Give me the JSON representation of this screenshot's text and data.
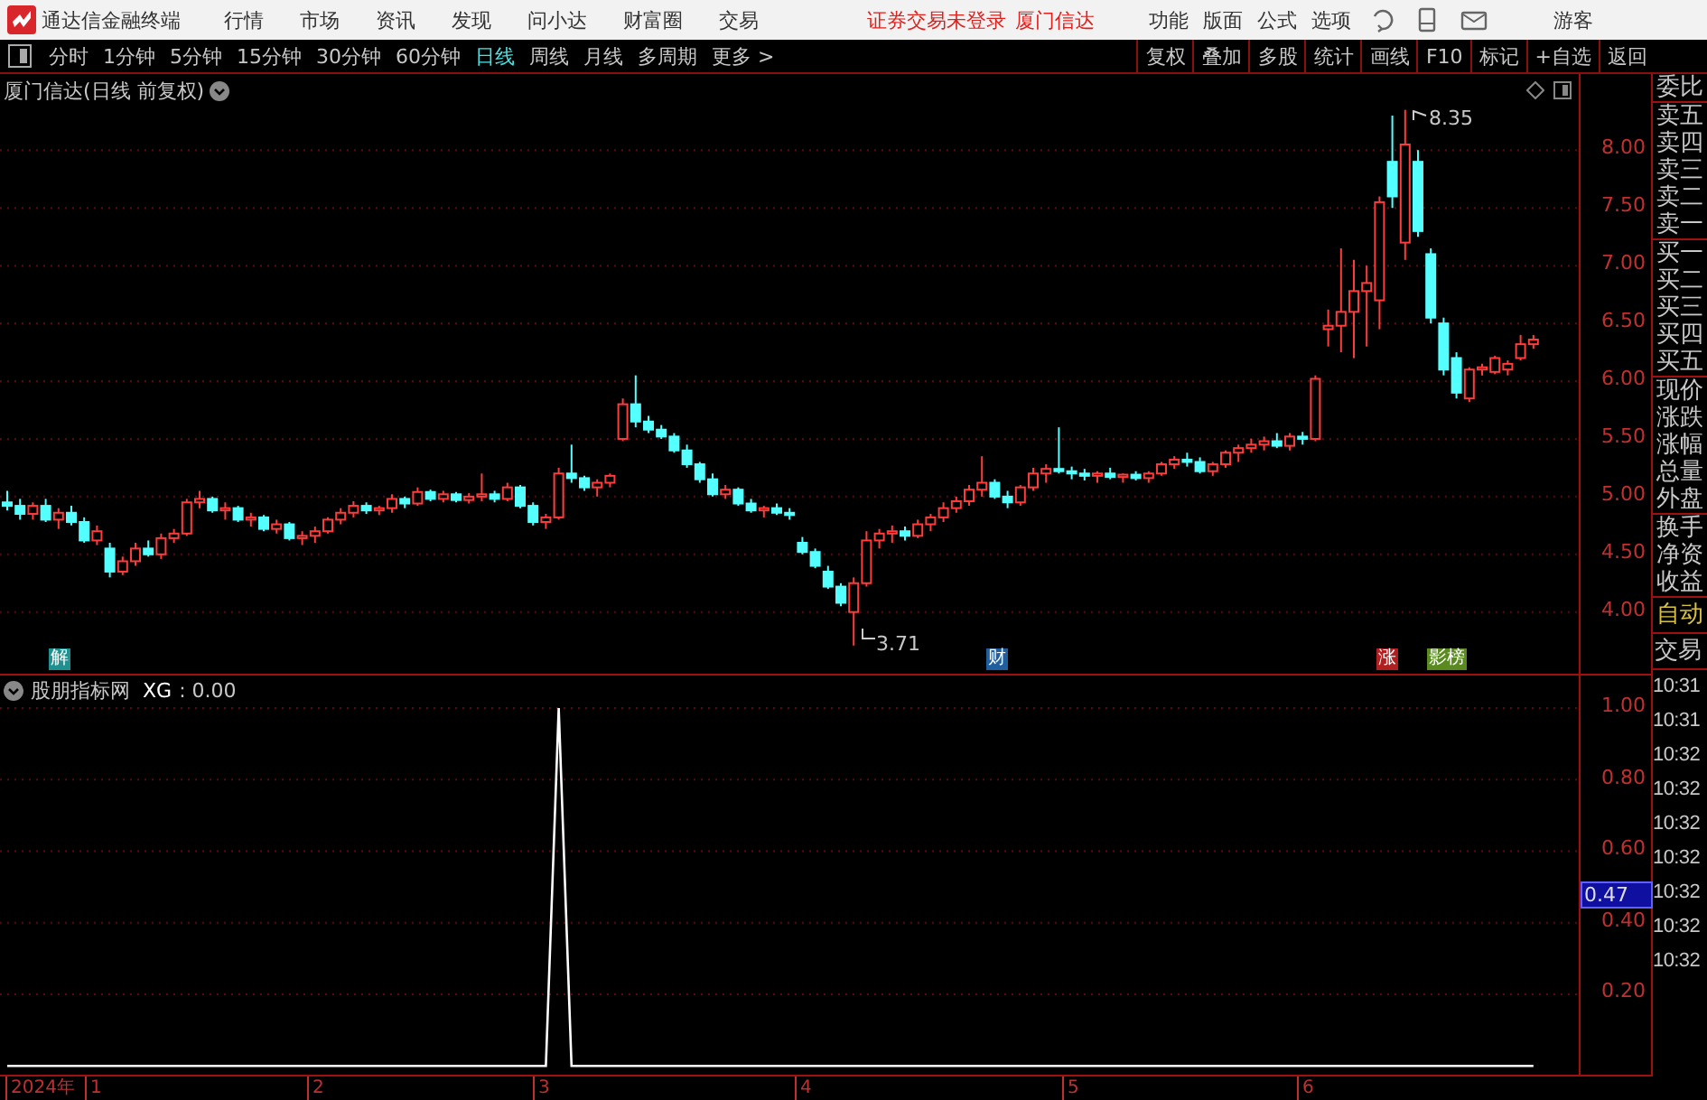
{
  "app": {
    "title": "通达信金融终端"
  },
  "menu": [
    "行情",
    "市场",
    "资讯",
    "发现",
    "问小达",
    "财富圈",
    "交易"
  ],
  "login_status": "证券交易未登录",
  "broker": "厦门信达",
  "right_menu": [
    "功能",
    "版面",
    "公式",
    "选项"
  ],
  "user": "游客",
  "periods": [
    {
      "label": "分时",
      "selected": false
    },
    {
      "label": "1分钟",
      "selected": false
    },
    {
      "label": "5分钟",
      "selected": false
    },
    {
      "label": "15分钟",
      "selected": false
    },
    {
      "label": "30分钟",
      "selected": false
    },
    {
      "label": "60分钟",
      "selected": false
    },
    {
      "label": "日线",
      "selected": true
    },
    {
      "label": "周线",
      "selected": false
    },
    {
      "label": "月线",
      "selected": false
    },
    {
      "label": "多周期",
      "selected": false
    },
    {
      "label": "更多 >",
      "selected": false
    }
  ],
  "tools": [
    "复权",
    "叠加",
    "多股",
    "统计",
    "画线",
    "F10",
    "标记",
    "+自选",
    "返回"
  ],
  "price_chart": {
    "title": "厦门信达(日线 前复权)",
    "high_label": "8.35",
    "low_label": "3.71",
    "events": [
      {
        "label": "解",
        "color": "#1f8f8f"
      },
      {
        "label": "财",
        "color": "#1f5f9f"
      },
      {
        "label": "涨",
        "color": "#b02020"
      },
      {
        "label": "影榜",
        "color": "#5a8a20"
      }
    ],
    "chart_data": {
      "type": "candlestick",
      "categories": [
        null,
        null,
        null,
        null,
        null,
        null,
        null,
        null,
        null,
        null,
        null,
        null,
        null,
        null,
        null,
        null,
        null,
        null,
        null,
        null,
        null,
        null,
        null,
        null,
        null,
        null,
        null,
        null,
        null,
        null,
        null,
        null,
        null,
        null,
        null,
        null,
        null,
        null,
        null,
        null,
        null,
        null,
        null,
        null,
        null,
        null,
        null,
        null,
        null,
        null,
        null,
        null,
        null,
        null,
        null,
        null,
        null,
        null,
        null,
        null,
        null,
        null,
        null,
        null,
        null,
        null,
        null,
        null,
        null,
        null,
        null,
        null,
        null,
        null,
        null,
        null,
        null,
        null,
        null,
        null,
        null,
        null,
        null,
        null,
        null,
        null,
        null,
        null,
        null,
        null,
        null,
        null,
        null,
        null,
        null,
        null,
        null,
        null,
        null,
        null,
        null,
        null,
        null,
        null,
        null,
        null,
        null,
        null,
        null,
        null,
        null,
        null,
        null,
        null,
        null,
        null,
        null,
        null,
        null,
        null
      ],
      "ylim": [
        3.45,
        8.66
      ],
      "grid": true,
      "yticks": [
        {
          "value": 8,
          "label": "8.00"
        },
        {
          "value": 7.5,
          "label": "7.50"
        },
        {
          "value": 7,
          "label": "7.00"
        },
        {
          "value": 6.5,
          "label": "6.50"
        },
        {
          "value": 6,
          "label": "6.00"
        },
        {
          "value": 5.5,
          "label": "5.50"
        },
        {
          "value": 5,
          "label": "5.00"
        },
        {
          "value": 4.5,
          "label": "4.50"
        },
        {
          "value": 4,
          "label": "4.00"
        }
      ],
      "ohlc": [
        [
          4.95,
          5.05,
          4.88,
          4.92
        ],
        [
          4.92,
          4.98,
          4.8,
          4.85
        ],
        [
          4.85,
          4.95,
          4.8,
          4.92
        ],
        [
          4.92,
          4.98,
          4.78,
          4.8
        ],
        [
          4.8,
          4.9,
          4.72,
          4.86
        ],
        [
          4.86,
          4.92,
          4.75,
          4.78
        ],
        [
          4.78,
          4.82,
          4.6,
          4.62
        ],
        [
          4.62,
          4.75,
          4.58,
          4.7
        ],
        [
          4.55,
          4.6,
          4.3,
          4.35
        ],
        [
          4.35,
          4.48,
          4.32,
          4.44
        ],
        [
          4.44,
          4.6,
          4.4,
          4.55
        ],
        [
          4.55,
          4.62,
          4.48,
          4.5
        ],
        [
          4.5,
          4.68,
          4.46,
          4.64
        ],
        [
          4.64,
          4.72,
          4.6,
          4.68
        ],
        [
          4.68,
          4.98,
          4.66,
          4.95
        ],
        [
          4.95,
          5.05,
          4.9,
          4.98
        ],
        [
          4.98,
          5.0,
          4.86,
          4.88
        ],
        [
          4.88,
          4.95,
          4.8,
          4.9
        ],
        [
          4.9,
          4.92,
          4.78,
          4.8
        ],
        [
          4.8,
          4.86,
          4.74,
          4.82
        ],
        [
          4.82,
          4.84,
          4.7,
          4.72
        ],
        [
          4.72,
          4.8,
          4.68,
          4.76
        ],
        [
          4.76,
          4.78,
          4.62,
          4.64
        ],
        [
          4.64,
          4.7,
          4.58,
          4.66
        ],
        [
          4.66,
          4.74,
          4.6,
          4.7
        ],
        [
          4.7,
          4.82,
          4.68,
          4.8
        ],
        [
          4.8,
          4.9,
          4.76,
          4.86
        ],
        [
          4.86,
          4.96,
          4.82,
          4.92
        ],
        [
          4.92,
          4.95,
          4.85,
          4.88
        ],
        [
          4.88,
          4.92,
          4.84,
          4.9
        ],
        [
          4.9,
          5.02,
          4.86,
          4.98
        ],
        [
          4.98,
          5.0,
          4.9,
          4.94
        ],
        [
          4.94,
          5.08,
          4.92,
          5.04
        ],
        [
          5.04,
          5.06,
          4.96,
          4.98
        ],
        [
          4.98,
          5.05,
          4.95,
          5.02
        ],
        [
          5.02,
          5.04,
          4.95,
          4.97
        ],
        [
          4.97,
          5.03,
          4.94,
          5.0
        ],
        [
          5.0,
          5.2,
          4.96,
          5.02
        ],
        [
          5.02,
          5.05,
          4.95,
          4.98
        ],
        [
          4.98,
          5.12,
          4.96,
          5.08
        ],
        [
          5.08,
          5.1,
          4.9,
          4.92
        ],
        [
          4.92,
          4.95,
          4.75,
          4.78
        ],
        [
          4.78,
          4.85,
          4.72,
          4.82
        ],
        [
          4.82,
          5.25,
          4.8,
          5.2
        ],
        [
          5.2,
          5.45,
          5.12,
          5.16
        ],
        [
          5.16,
          5.18,
          5.05,
          5.08
        ],
        [
          5.08,
          5.15,
          5.0,
          5.12
        ],
        [
          5.12,
          5.2,
          5.08,
          5.18
        ],
        [
          5.5,
          5.85,
          5.48,
          5.8
        ],
        [
          5.8,
          6.05,
          5.6,
          5.65
        ],
        [
          5.65,
          5.7,
          5.55,
          5.58
        ],
        [
          5.58,
          5.62,
          5.5,
          5.52
        ],
        [
          5.52,
          5.55,
          5.38,
          5.4
        ],
        [
          5.4,
          5.45,
          5.25,
          5.28
        ],
        [
          5.28,
          5.3,
          5.12,
          5.15
        ],
        [
          5.15,
          5.2,
          5.0,
          5.02
        ],
        [
          5.02,
          5.1,
          4.98,
          5.06
        ],
        [
          5.06,
          5.08,
          4.92,
          4.94
        ],
        [
          4.94,
          4.98,
          4.86,
          4.88
        ],
        [
          4.88,
          4.92,
          4.82,
          4.9
        ],
        [
          4.9,
          4.94,
          4.84,
          4.86
        ],
        [
          4.86,
          4.9,
          4.8,
          4.84
        ],
        [
          4.6,
          4.65,
          4.5,
          4.52
        ],
        [
          4.52,
          4.55,
          4.38,
          4.4
        ],
        [
          4.35,
          4.4,
          4.2,
          4.22
        ],
        [
          4.22,
          4.25,
          4.05,
          4.08
        ],
        [
          4.0,
          4.3,
          3.71,
          4.25
        ],
        [
          4.25,
          4.7,
          4.22,
          4.62
        ],
        [
          4.62,
          4.72,
          4.55,
          4.68
        ],
        [
          4.68,
          4.75,
          4.6,
          4.7
        ],
        [
          4.7,
          4.74,
          4.62,
          4.66
        ],
        [
          4.66,
          4.8,
          4.64,
          4.76
        ],
        [
          4.76,
          4.85,
          4.7,
          4.82
        ],
        [
          4.82,
          4.95,
          4.78,
          4.9
        ],
        [
          4.9,
          5.0,
          4.86,
          4.96
        ],
        [
          4.96,
          5.1,
          4.92,
          5.06
        ],
        [
          5.06,
          5.35,
          5.0,
          5.12
        ],
        [
          5.12,
          5.15,
          4.98,
          5.0
        ],
        [
          5.0,
          5.05,
          4.9,
          4.95
        ],
        [
          4.95,
          5.1,
          4.92,
          5.08
        ],
        [
          5.08,
          5.25,
          5.05,
          5.2
        ],
        [
          5.2,
          5.28,
          5.12,
          5.24
        ],
        [
          5.24,
          5.6,
          5.2,
          5.22
        ],
        [
          5.22,
          5.26,
          5.15,
          5.2
        ],
        [
          5.2,
          5.24,
          5.14,
          5.18
        ],
        [
          5.18,
          5.22,
          5.12,
          5.2
        ],
        [
          5.2,
          5.25,
          5.15,
          5.17
        ],
        [
          5.17,
          5.2,
          5.12,
          5.19
        ],
        [
          5.19,
          5.22,
          5.14,
          5.16
        ],
        [
          5.16,
          5.22,
          5.12,
          5.2
        ],
        [
          5.2,
          5.3,
          5.18,
          5.28
        ],
        [
          5.28,
          5.35,
          5.24,
          5.32
        ],
        [
          5.32,
          5.38,
          5.26,
          5.3
        ],
        [
          5.3,
          5.34,
          5.2,
          5.22
        ],
        [
          5.22,
          5.3,
          5.18,
          5.28
        ],
        [
          5.28,
          5.4,
          5.25,
          5.38
        ],
        [
          5.38,
          5.45,
          5.3,
          5.42
        ],
        [
          5.42,
          5.5,
          5.38,
          5.45
        ],
        [
          5.45,
          5.52,
          5.4,
          5.48
        ],
        [
          5.48,
          5.55,
          5.42,
          5.44
        ],
        [
          5.44,
          5.55,
          5.4,
          5.52
        ],
        [
          5.52,
          5.56,
          5.45,
          5.5
        ],
        [
          5.5,
          6.05,
          5.48,
          6.02
        ],
        [
          6.45,
          6.62,
          6.3,
          6.48
        ],
        [
          6.48,
          7.15,
          6.25,
          6.6
        ],
        [
          6.6,
          7.05,
          6.2,
          6.78
        ],
        [
          6.78,
          7.0,
          6.3,
          6.85
        ],
        [
          6.7,
          7.6,
          6.45,
          7.55
        ],
        [
          7.9,
          8.3,
          7.5,
          7.6
        ],
        [
          7.2,
          8.35,
          7.05,
          8.05
        ],
        [
          7.9,
          8.0,
          7.25,
          7.3
        ],
        [
          7.1,
          7.15,
          6.5,
          6.55
        ],
        [
          6.5,
          6.55,
          6.05,
          6.1
        ],
        [
          6.2,
          6.25,
          5.85,
          5.9
        ],
        [
          5.85,
          6.12,
          5.82,
          6.1
        ],
        [
          6.1,
          6.15,
          6.05,
          6.12
        ],
        [
          6.08,
          6.22,
          6.06,
          6.2
        ],
        [
          6.1,
          6.18,
          6.05,
          6.15
        ],
        [
          6.2,
          6.4,
          6.18,
          6.32
        ],
        [
          6.32,
          6.4,
          6.28,
          6.36
        ]
      ]
    }
  },
  "indicator": {
    "title": "股朋指标网",
    "reading": ": 0.00",
    "cursor_value": "0.47",
    "chart_data": {
      "type": "line",
      "categories": [
        null,
        null,
        null,
        null,
        null,
        null,
        null,
        null,
        null,
        null,
        null,
        null,
        null,
        null,
        null,
        null,
        null,
        null,
        null,
        null,
        null,
        null,
        null,
        null,
        null,
        null,
        null,
        null,
        null,
        null,
        null,
        null,
        null,
        null,
        null,
        null,
        null,
        null,
        null,
        null,
        null,
        null,
        null,
        null,
        null,
        null,
        null,
        null,
        null,
        null,
        null,
        null,
        null,
        null,
        null,
        null,
        null,
        null,
        null,
        null,
        null,
        null,
        null,
        null,
        null,
        null,
        null,
        null,
        null,
        null,
        null,
        null,
        null,
        null,
        null,
        null,
        null,
        null,
        null,
        null,
        null,
        null,
        null,
        null,
        null,
        null,
        null,
        null,
        null,
        null,
        null,
        null,
        null,
        null,
        null,
        null,
        null,
        null,
        null,
        null,
        null,
        null,
        null,
        null,
        null,
        null,
        null,
        null,
        null,
        null,
        null,
        null,
        null,
        null,
        null,
        null,
        null,
        null,
        null,
        null
      ],
      "ylim": [
        -0.03,
        1
      ],
      "grid": true,
      "yticks": [
        {
          "value": 0.2,
          "label": "0.20"
        },
        {
          "value": 0.4,
          "label": "0.40"
        },
        {
          "value": 0.6,
          "label": "0.60"
        },
        {
          "value": 0.8,
          "label": "0.80"
        },
        {
          "value": 1,
          "label": "1.00"
        }
      ],
      "series": [
        {
          "name": "XG",
          "color": "#ffffff",
          "values": [
            0,
            0,
            0,
            0,
            0,
            0,
            0,
            0,
            0,
            0,
            0,
            0,
            0,
            0,
            0,
            0,
            0,
            0,
            0,
            0,
            0,
            0,
            0,
            0,
            0,
            0,
            0,
            0,
            0,
            0,
            0,
            0,
            0,
            0,
            0,
            0,
            0,
            0,
            0,
            0,
            0,
            0,
            0,
            1,
            0,
            0,
            0,
            0,
            0,
            0,
            0,
            0,
            0,
            0,
            0,
            0,
            0,
            0,
            0,
            0,
            0,
            0,
            0,
            0,
            0,
            0,
            0,
            0,
            0,
            0,
            0,
            0,
            0,
            0,
            0,
            0,
            0,
            0,
            0,
            0,
            0,
            0,
            0,
            0,
            0,
            0,
            0,
            0,
            0,
            0,
            0,
            0,
            0,
            0,
            0,
            0,
            0,
            0,
            0,
            0,
            0,
            0,
            0,
            0,
            0,
            0,
            0,
            0,
            0,
            0,
            0,
            0,
            0,
            0,
            0,
            0,
            0,
            0,
            0,
            0
          ]
        }
      ]
    }
  },
  "dates": [
    "2024年",
    "1",
    "2",
    "3",
    "4",
    "5",
    "6"
  ],
  "sidebar": {
    "groups": [
      [
        "委比"
      ],
      [
        "卖五",
        "卖四",
        "卖三",
        "卖二",
        "卖一"
      ],
      [
        "买一",
        "买二",
        "买三",
        "买四",
        "买五"
      ],
      [
        "现价",
        "涨跌",
        "涨幅",
        "总量",
        "外盘"
      ],
      [
        "换手",
        "净资",
        "收益"
      ]
    ],
    "mode": "自动",
    "trade_label": "交易",
    "times": [
      "10:31",
      "10:31",
      "10:32",
      "10:32",
      "10:32",
      "10:32",
      "10:32",
      "10:32",
      "10:32"
    ]
  }
}
